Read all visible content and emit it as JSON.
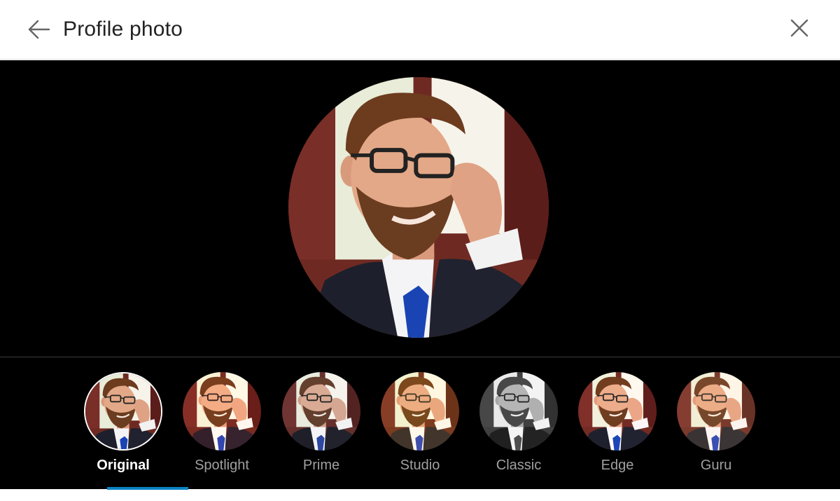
{
  "header": {
    "title": "Profile photo",
    "back_icon": "arrow-left-icon",
    "close_icon": "close-icon"
  },
  "photo": {
    "description_icon": "profile-photo"
  },
  "filters": {
    "selected_index": 0,
    "items": [
      {
        "label": "Original"
      },
      {
        "label": "Spotlight"
      },
      {
        "label": "Prime"
      },
      {
        "label": "Studio"
      },
      {
        "label": "Classic"
      },
      {
        "label": "Edge"
      },
      {
        "label": "Guru"
      }
    ]
  },
  "colors": {
    "accent": "#0a84c6",
    "stage_background": "#000000",
    "header_background": "#ffffff"
  }
}
